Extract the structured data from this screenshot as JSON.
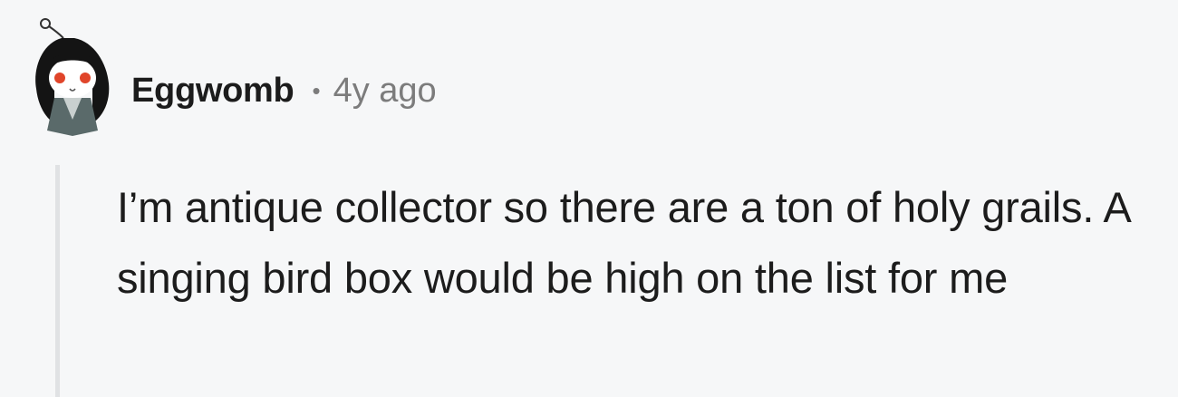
{
  "comment": {
    "author": "Eggwomb",
    "separator": "•",
    "timestamp": "4y ago",
    "body": "I’m antique collector so there are a ton of holy grails. A singing bird box would be high on the list for me"
  },
  "icons": {
    "avatar": "snoo-avatar-icon"
  }
}
